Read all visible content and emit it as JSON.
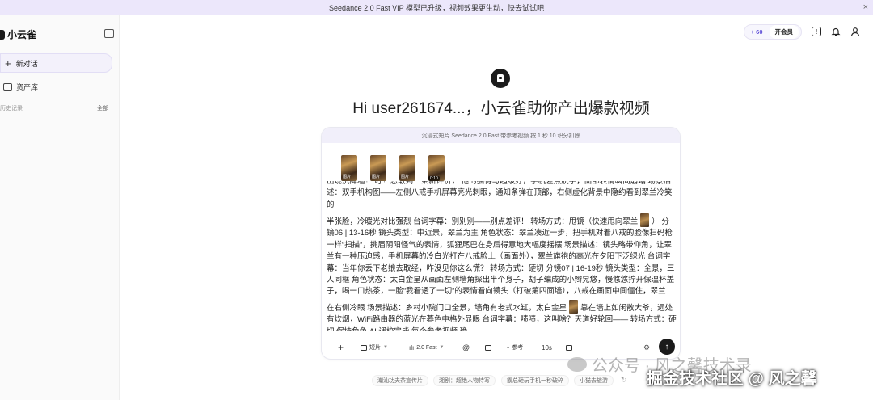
{
  "banner": {
    "text": "Seedance 2.0 Fast VIP 模型已升级，视频效果更生动，快去试试吧",
    "close": "×"
  },
  "sidebar": {
    "logo": "小云雀",
    "new_chat": "新对话",
    "assets": "资产库",
    "history_label": "历史记录",
    "history_all": "全部"
  },
  "header": {
    "credits": "+ 60",
    "vip": "开会员"
  },
  "hero": {
    "title": "Hi user261674...，小云雀助你产出爆款视频"
  },
  "composer": {
    "notice": "沉浸式短片 Seedance 2.0 Fast 带参考视频 按 1 秒 10 积分扣除",
    "thumbs": [
      {
        "label": "图片",
        "video": false
      },
      {
        "label": "图片",
        "video": false
      },
      {
        "label": "图片",
        "video": false
      },
      {
        "label": "0:10",
        "video": true
      }
    ],
    "text1": "出现沉降墙！ 叮！恋取到一条新评价， 他的猫得与超级好，手机差点脱手，面部表情瞬间崩塌 场景描述：双手机构图——左侧八戒手机屏幕亮光刺眼，通知条弹在顶部，右侧虚化背景中隐约看到翠兰冷笑的",
    "text2a": "半张脸，冷暖光对比强烈 台词字幕：别别别——别点差评！ 转场方式：甩镜（快速甩向翠兰",
    "text2b": "） 分镜06 | 13-16秒 镜头类型：中近景，翠兰为主 角色状态：翠兰凑近一步，把手机对着八戒的脸像扫码枪一样“扫描”，挑眉阴阳怪气的表情，狐狸尾巴在身后得意地大幅度摇摆 场景描述：镜头略带仰角，让翠兰有一种压迫感，手机屏幕的冷白光打在八戒脸上（画面外），翠兰旗袍的高光在夕阳下泛绿光 台词字幕：当年你丢下老娘去取经，咋没见你这么慌？ 转场方式：硬切 分镜07 | 16-19秒 镜头类型：全景，三人同框 角色状态：太白金星从画面左侧墙角探出半个身子，胡子编成的小辫晃悠，慢悠悠拧开保温杯盖子，喝一口热茶，一脸“我看透了一切”的表情看向镜头（打破第四面墙），八戒在画面中间僵住，翠兰",
    "text3a": "在右侧冷眼 场景描述：乡村小院门口全景，墙角有老式水缸，太白金星",
    "text3b": "靠在墙上如闲散大爷，远处有炊烟，WiFi路由器的蓝光在暮色中格外显眼 台词字幕：啧啧，这叫啥？天道好轮回—— 转场方式：硬切 保持角色 AI 调校完毕 每个参考视频 确",
    "toolbar": {
      "plus": "+",
      "mode": "短片",
      "model": "2.0 Fast",
      "reference": "参考",
      "duration": "10s",
      "send": "↑"
    }
  },
  "suggestions": [
    "潮汕功夫茶宣传片",
    "湘剧：超绝人物特写",
    "霸总砸玩手机一秒破碎",
    "小猫去旅游"
  ],
  "watermark": {
    "line1": "公众号 · 风之馨技术录",
    "line2": "掘金技术社区 @ 风之馨"
  }
}
